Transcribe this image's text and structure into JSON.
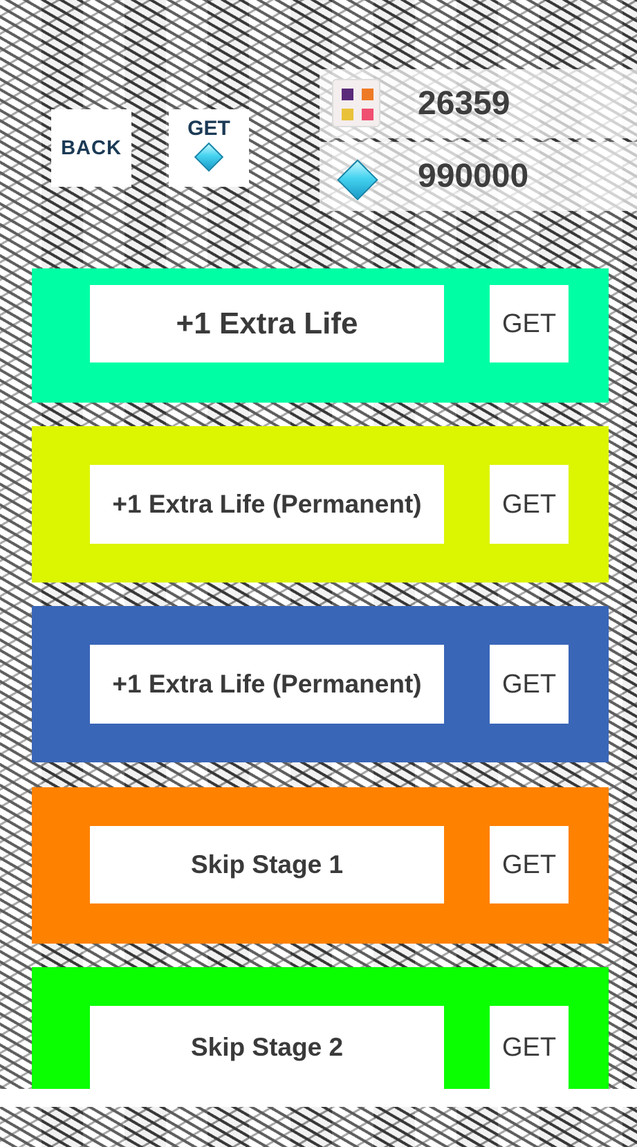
{
  "topbar": {
    "back_label": "BACK",
    "get_gems_label": "GET",
    "gem_icon": "diamond-gem-icon"
  },
  "wallet": {
    "coins": "26359",
    "coin_icon": "colored-tiles-icon",
    "gems": "990000",
    "gem_icon": "diamond-gem-icon"
  },
  "shop": {
    "items": [
      {
        "label": "+1 Extra Life",
        "button": "GET",
        "color": "#00ffa4"
      },
      {
        "label": "+1 Extra Life (Permanent)",
        "button": "GET",
        "color": "#dcf500"
      },
      {
        "label": "+1 Extra Life (Permanent)",
        "button": "GET",
        "color": "#3a66b8"
      },
      {
        "label": "Skip Stage 1",
        "button": "GET",
        "color": "#ff8100"
      },
      {
        "label": "Skip Stage 2",
        "button": "GET",
        "color": "#0aff00"
      }
    ]
  },
  "colors": {
    "tile_purple": "#5a2a7a",
    "tile_orange": "#ee7a25",
    "tile_yellow": "#e9c23a",
    "tile_pink": "#ef4f70",
    "text_dark": "#3a3a3a",
    "back_text": "#1b3a55"
  }
}
